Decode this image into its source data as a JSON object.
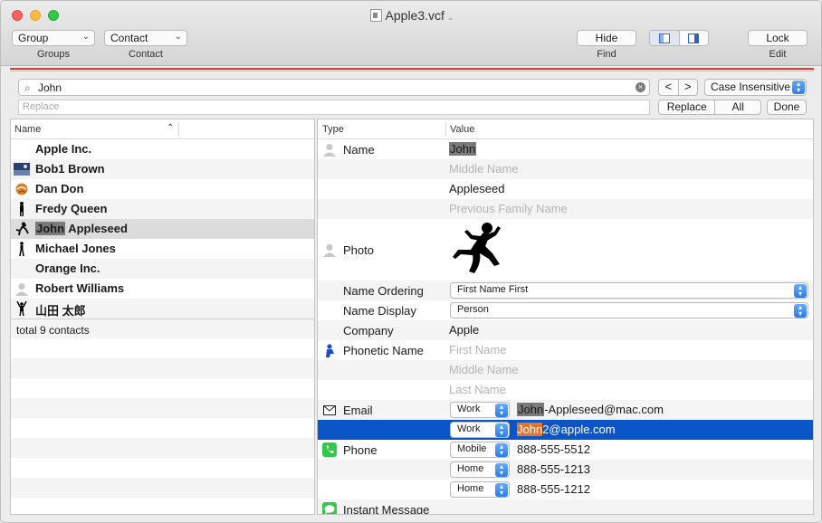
{
  "window": {
    "title": "Apple3.vcf"
  },
  "toolbar": {
    "group_popup": "Group",
    "groups_label": "Groups",
    "contact_popup": "Contact",
    "contact_label": "Contact",
    "hide_button": "Hide",
    "find_label": "Find",
    "lock_button": "Lock",
    "edit_label": "Edit"
  },
  "find": {
    "query": "John",
    "replace_placeholder": "Replace",
    "prev": "<",
    "next": ">",
    "case_option": "Case Insensitive",
    "replace_button": "Replace",
    "all_button": "All",
    "done_button": "Done"
  },
  "contacts": {
    "column_header": "Name",
    "items": [
      {
        "name": "Apple Inc.",
        "icon": "none"
      },
      {
        "name": "Bob1 Brown",
        "icon": "landscape-photo-icon"
      },
      {
        "name": "Dan Don",
        "icon": "ball-icon"
      },
      {
        "name": "Fredy Queen",
        "icon": "standing-figure-icon"
      },
      {
        "name_match": "John",
        "name_rest": " Appleseed",
        "icon": "jumping-figure-icon"
      },
      {
        "name": "Michael Jones",
        "icon": "walking-figure-icon"
      },
      {
        "name": "Orange Inc.",
        "icon": "none"
      },
      {
        "name": "Robert Williams",
        "icon": "person-silhouette-icon"
      },
      {
        "name": "山田 太郎",
        "icon": "arms-up-figure-icon"
      }
    ],
    "total": "total 9 contacts"
  },
  "properties": {
    "type_header": "Type",
    "value_header": "Value",
    "name_label": "Name",
    "first_name": "John",
    "middle_name_placeholder": "Middle Name",
    "last_name": "Appleseed",
    "previous_family_placeholder": "Previous Family Name",
    "photo_label": "Photo",
    "name_ordering_label": "Name Ordering",
    "name_ordering_value": "First Name First",
    "name_display_label": "Name Display",
    "name_display_value": "Person",
    "company_label": "Company",
    "company_value": "Apple",
    "phonetic_label": "Phonetic Name",
    "phonetic_first_placeholder": "First Name",
    "phonetic_middle_placeholder": "Middle Name",
    "phonetic_last_placeholder": "Last Name",
    "email_label": "Email",
    "email1_type": "Work",
    "email1_match": "John",
    "email1_rest": "-Appleseed@mac.com",
    "email2_type": "Work",
    "email2_match": "John",
    "email2_rest": "2@apple.com",
    "phone_label": "Phone",
    "phone1_type": "Mobile",
    "phone1_value": "888-555-5512",
    "phone2_type": "Home",
    "phone2_value": "888-555-1213",
    "phone3_type": "Home",
    "phone3_value": "888-555-1212",
    "im_label": "Instant Message"
  },
  "colors": {
    "accent": "#0a55c8",
    "highlight": "#7a7a7a",
    "active_match": "#e8722a",
    "find_bar_line": "#e23a2f"
  }
}
